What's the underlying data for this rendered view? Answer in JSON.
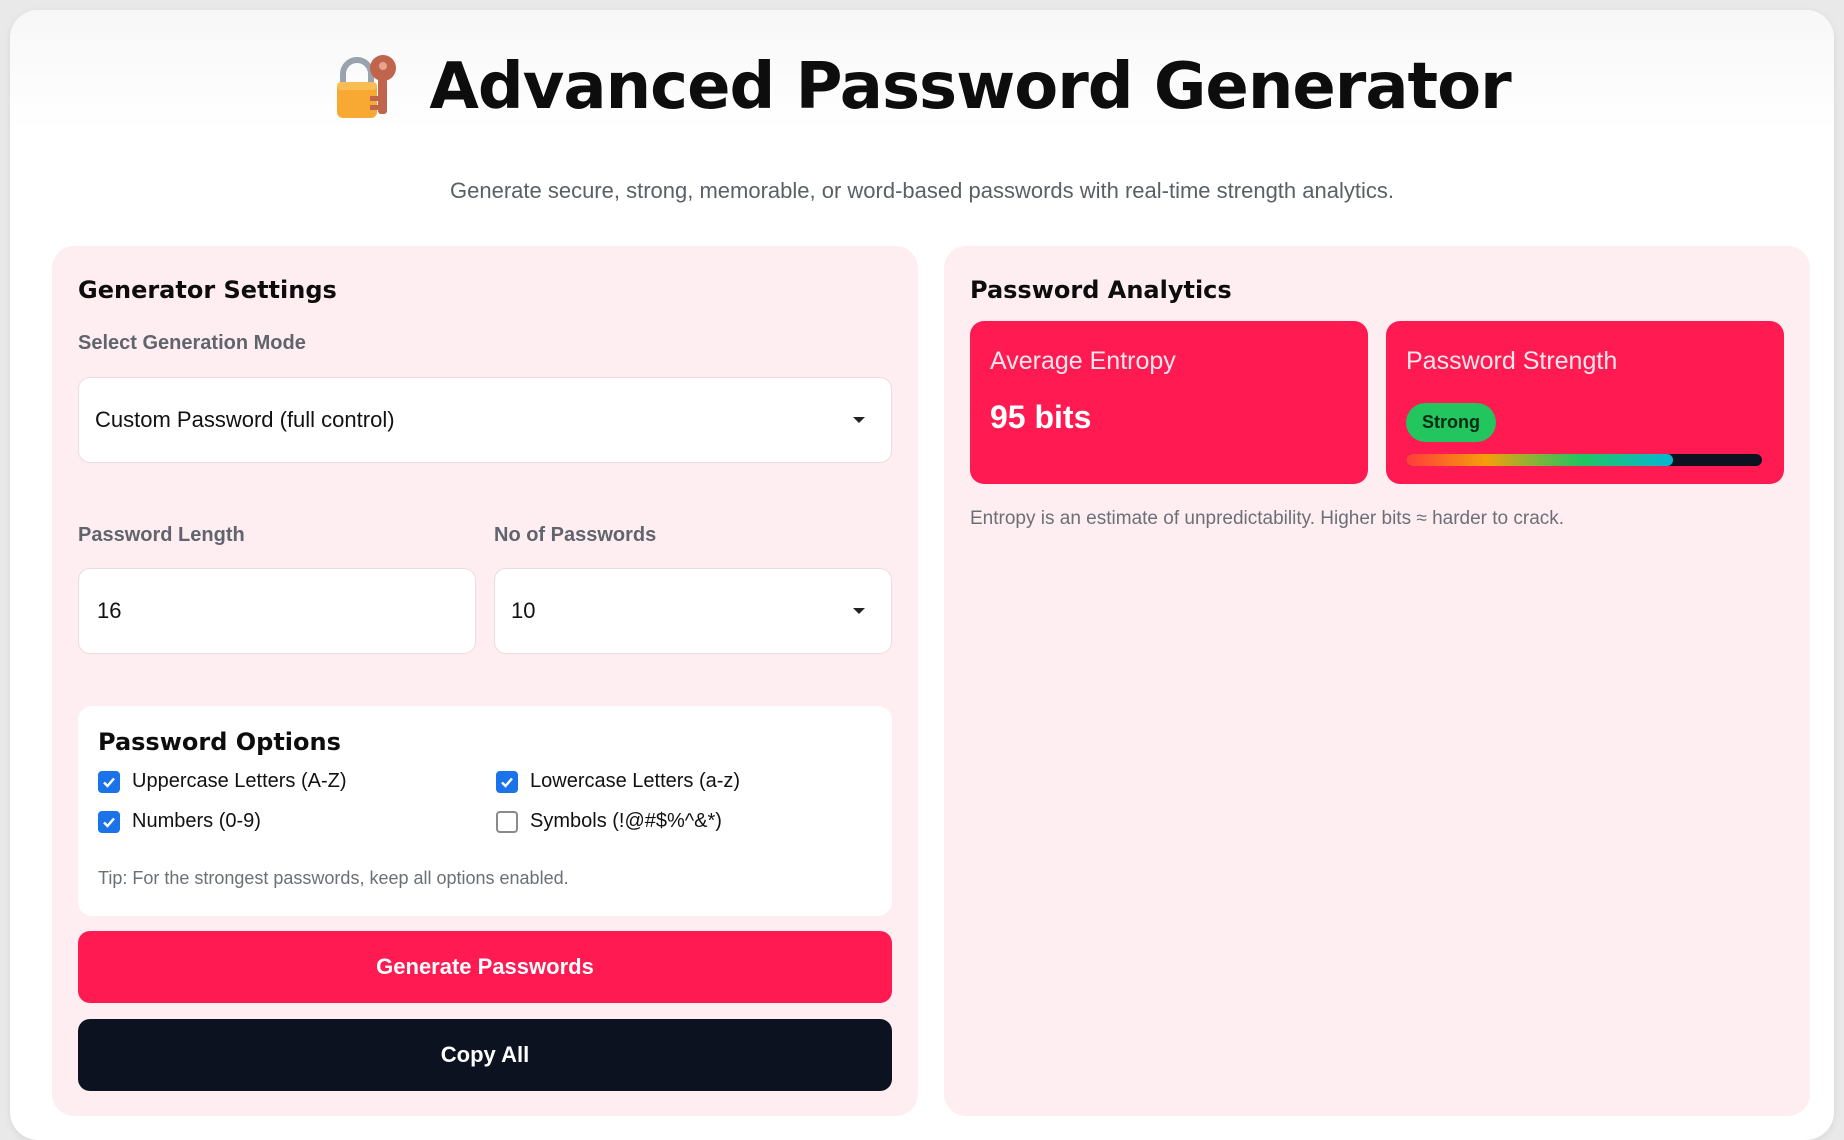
{
  "header": {
    "title": "Advanced Password Generator",
    "subtitle": "Generate secure, strong, memorable, or word-based passwords with real-time strength analytics.",
    "icon": "locked-with-key-icon"
  },
  "settings": {
    "title": "Generator Settings",
    "mode_label": "Select Generation Mode",
    "mode_value": "Custom Password (full control)",
    "length_label": "Password Length",
    "length_value": "16",
    "count_label": "No of Passwords",
    "count_value": "10"
  },
  "options": {
    "title": "Password Options",
    "items": [
      {
        "label": "Uppercase Letters (A-Z)",
        "checked": true
      },
      {
        "label": "Lowercase Letters (a-z)",
        "checked": true
      },
      {
        "label": "Numbers (0-9)",
        "checked": true
      },
      {
        "label": "Symbols (!@#$%^&*)",
        "checked": false
      }
    ],
    "tip": "Tip: For the strongest passwords, keep all options enabled."
  },
  "buttons": {
    "generate": "Generate Passwords",
    "copy_all": "Copy All"
  },
  "analytics": {
    "title": "Password Analytics",
    "entropy_label": "Average Entropy",
    "entropy_value": "95 bits",
    "strength_label": "Password Strength",
    "strength_badge": "Strong",
    "strength_level_percent": 75,
    "note": "Entropy is an estimate of unpredictability. Higher bits ≈ harder to crack."
  },
  "colors": {
    "accent": "#ff1a52",
    "panel_bg": "#ffeef1",
    "dark_button": "#0c1220",
    "badge_green": "#22c55e",
    "checkbox_blue": "#1a73e8"
  }
}
